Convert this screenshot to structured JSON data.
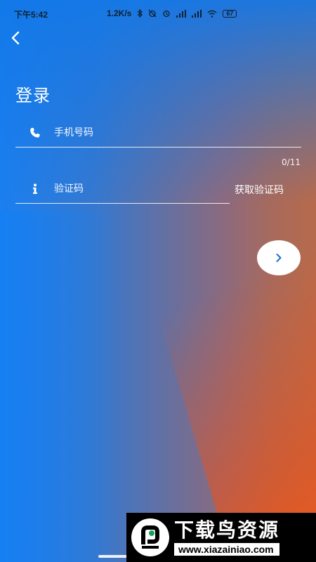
{
  "status_bar": {
    "time": "下午5:42",
    "network_speed": "1.2K/s",
    "battery": "67",
    "icons": [
      "bluetooth-icon",
      "alarm-off-icon",
      "alarm-icon",
      "signal-icon",
      "signal-icon",
      "wifi-icon",
      "battery-icon"
    ]
  },
  "header": {
    "back_icon": "chevron-left-icon",
    "title": "登录"
  },
  "form": {
    "phone": {
      "icon": "phone-icon",
      "placeholder": "手机号码",
      "value": "",
      "counter": "0/11"
    },
    "code": {
      "icon": "info-icon",
      "placeholder": "验证码",
      "value": ""
    },
    "get_code_label": "获取验证码",
    "next_icon": "chevron-right-icon"
  },
  "watermark": {
    "title": "下载鸟资源",
    "url": "www.xiazainiao.com"
  },
  "colors": {
    "accent_blue": "#1a7ff0",
    "accent_orange": "#f05a14",
    "next_chevron": "#1a6fd0"
  }
}
